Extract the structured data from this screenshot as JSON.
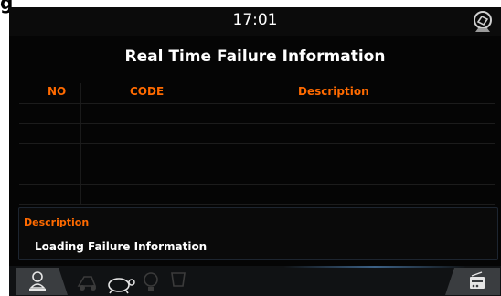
{
  "corner_label": "g",
  "header": {
    "time": "17:01"
  },
  "page": {
    "title": "Real Time Failure Information"
  },
  "table": {
    "columns": [
      "NO",
      "CODE",
      "Description"
    ],
    "rows": []
  },
  "description": {
    "label": "Description",
    "text": "Loading Failure Information"
  },
  "colors": {
    "accent": "#ff6a00",
    "background": "#050505",
    "text": "#ffffff"
  },
  "icons": {
    "top_right": "reset-icon",
    "bottom": [
      "operator-icon",
      "machine-icon",
      "turtle-icon",
      "bulb-icon",
      "cup-icon",
      "radio-icon"
    ]
  }
}
